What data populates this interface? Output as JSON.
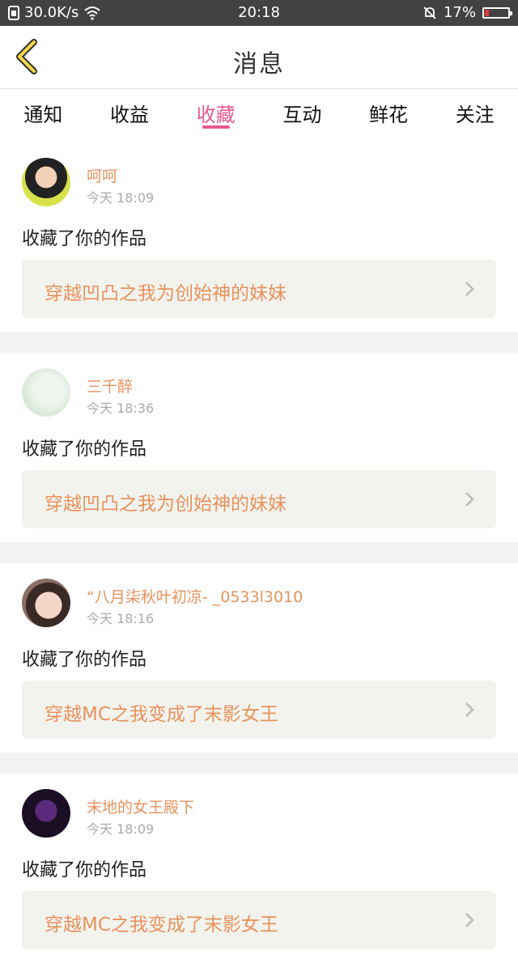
{
  "status_bar": {
    "speed": "30.0K/s",
    "time": "20:18",
    "battery": "17%",
    "battery_level": 0.17
  },
  "header": {
    "title": "消息",
    "back_icon": "chevron-left-icon"
  },
  "tabs": [
    {
      "label": "通知",
      "active": false
    },
    {
      "label": "收益",
      "active": false
    },
    {
      "label": "收藏",
      "active": true
    },
    {
      "label": "互动",
      "active": false
    },
    {
      "label": "鲜花",
      "active": false
    },
    {
      "label": "关注",
      "active": false
    }
  ],
  "items": [
    {
      "name": "呵呵",
      "time": "今天 18:09",
      "action": "收藏了你的作品",
      "work": "穿越凹凸之我为创始神的妹妹"
    },
    {
      "name": "三千醉",
      "time": "今天 18:36",
      "action": "收藏了你的作品",
      "work": "穿越凹凸之我为创始神的妹妹"
    },
    {
      "name": "“八月柒秋叶初凉-  _0533l3010",
      "time": "今天 18:16",
      "action": "收藏了你的作品",
      "work": "穿越MC之我变成了末影女王"
    },
    {
      "name": "末地的女王殿下",
      "time": "今天 18:09",
      "action": "收藏了你的作品",
      "work": "穿越MC之我变成了末影女王"
    }
  ],
  "colors": {
    "accent": "#e8588c",
    "name": "#e8925c",
    "status_bar": "#424242",
    "work_bg": "#f3f3ee"
  }
}
